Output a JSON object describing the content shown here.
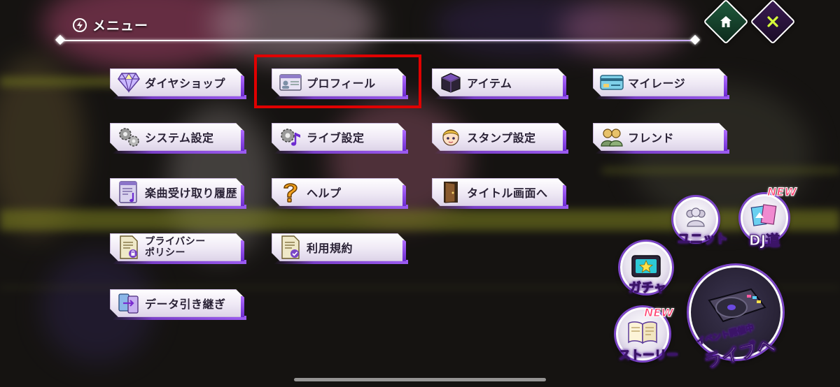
{
  "header": {
    "title": "メニュー",
    "home_icon": "home-icon",
    "close_icon": "close-x-icon",
    "accent_color": "#7b45c6"
  },
  "menu": {
    "row1": [
      {
        "label": "ダイヤショップ",
        "icon": "diamond-icon"
      },
      {
        "label": "プロフィール",
        "icon": "profile-card-icon",
        "highlighted": true
      },
      {
        "label": "アイテム",
        "icon": "item-box-icon"
      },
      {
        "label": "マイレージ",
        "icon": "mileage-card-icon"
      }
    ],
    "row2": [
      {
        "label": "システム設定",
        "icon": "gears-icon"
      },
      {
        "label": "ライブ設定",
        "icon": "gear-music-icon"
      },
      {
        "label": "スタンプ設定",
        "icon": "character-face-icon"
      },
      {
        "label": "フレンド",
        "icon": "friends-icon"
      }
    ],
    "row3": [
      {
        "label": "楽曲受け取り履歴",
        "icon": "song-list-icon"
      },
      {
        "label": "ヘルプ",
        "icon": "question-icon"
      },
      {
        "label": "タイトル画面へ",
        "icon": "door-icon"
      }
    ],
    "row4": [
      {
        "label_line1": "プライバシー",
        "label_line2": "ポリシー",
        "icon": "privacy-doc-icon"
      },
      {
        "label": "利用規約",
        "icon": "terms-doc-icon"
      }
    ],
    "row5": [
      {
        "label": "データ引き継ぎ",
        "icon": "data-transfer-icon"
      }
    ]
  },
  "shortcuts": {
    "unit": {
      "label": "ユニット",
      "icon": "unit-people-icon"
    },
    "dj_road": {
      "label": "DJ道",
      "icon": "dj-road-icon",
      "badge": "NEW"
    },
    "gacha": {
      "label": "ガチャ",
      "icon": "gacha-star-icon"
    },
    "story": {
      "label": "ストーリー",
      "icon": "book-icon",
      "badge": "NEW"
    },
    "live": {
      "label_small": "イベント開催中",
      "label_large": "ライブへ",
      "icon": "dj-turntable-icon"
    }
  },
  "highlight_color": "#e00000"
}
